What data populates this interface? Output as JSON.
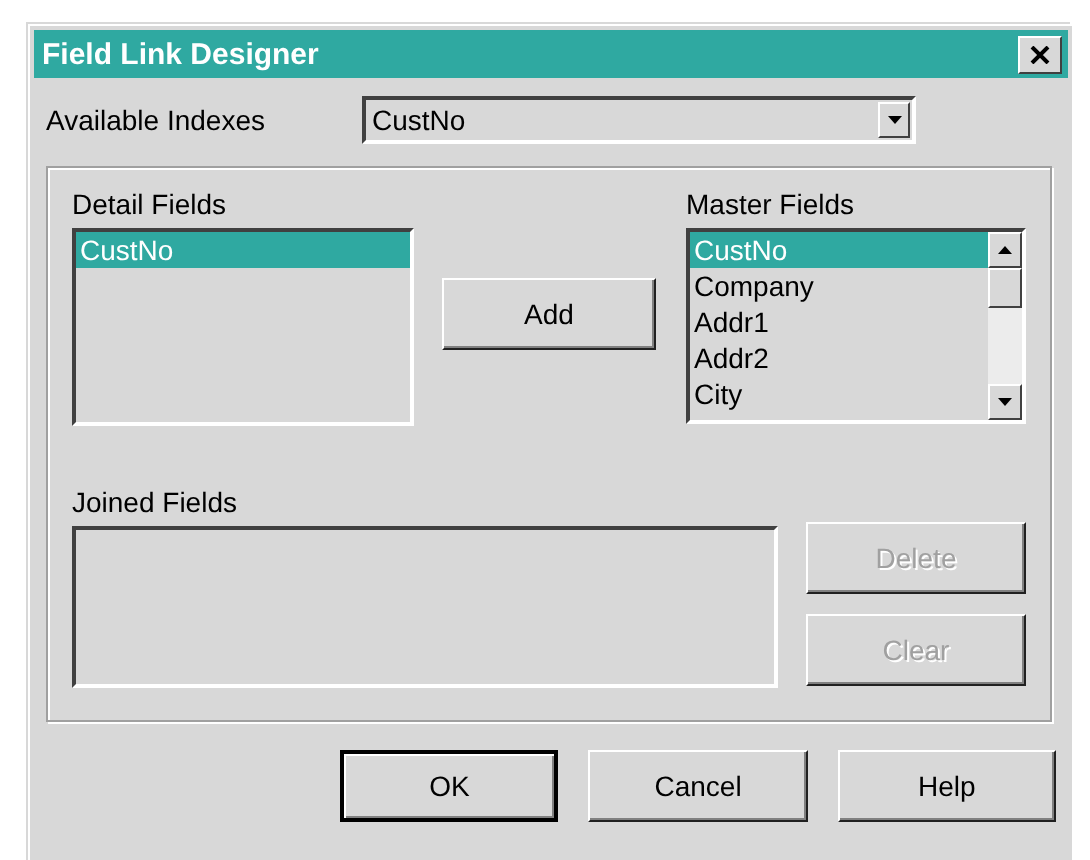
{
  "window": {
    "title": "Field Link Designer"
  },
  "index_field": {
    "label": "Available Indexes",
    "value": "CustNo"
  },
  "detail_fields": {
    "label": "Detail Fields",
    "items": [
      {
        "text": "CustNo",
        "selected": true
      }
    ]
  },
  "add_button": {
    "label": "Add"
  },
  "master_fields": {
    "label": "Master Fields",
    "items": [
      {
        "text": "CustNo",
        "selected": true
      },
      {
        "text": "Company",
        "selected": false
      },
      {
        "text": "Addr1",
        "selected": false
      },
      {
        "text": "Addr2",
        "selected": false
      },
      {
        "text": "City",
        "selected": false
      }
    ]
  },
  "joined_fields": {
    "label": "Joined Fields"
  },
  "side_buttons": [
    {
      "label": "Delete",
      "disabled": true
    },
    {
      "label": "Clear",
      "disabled": true
    }
  ],
  "buttons": [
    {
      "label": "OK",
      "default": true
    },
    {
      "label": "Cancel",
      "default": false
    },
    {
      "label": "Help",
      "default": false
    }
  ]
}
